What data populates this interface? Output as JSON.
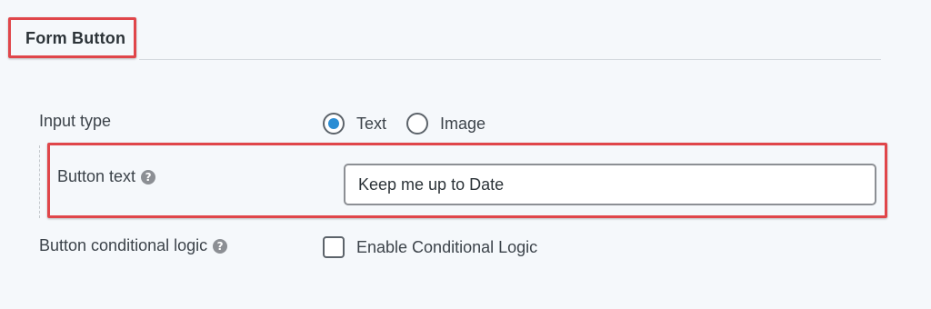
{
  "section": {
    "title": "Form Button"
  },
  "fields": {
    "input_type": {
      "label": "Input type",
      "options": [
        {
          "label": "Text",
          "checked": true
        },
        {
          "label": "Image",
          "checked": false
        }
      ]
    },
    "button_text": {
      "label": "Button text",
      "value": "Keep me up to Date",
      "help_icon": "question-circle-icon"
    },
    "conditional_logic": {
      "label": "Button conditional logic",
      "help_icon": "question-circle-icon",
      "checkbox_label": "Enable Conditional Logic",
      "checked": false
    }
  },
  "colors": {
    "background": "#f5f8fb",
    "highlight": "#e0464a",
    "radio_selected": "#2a8dd4"
  }
}
